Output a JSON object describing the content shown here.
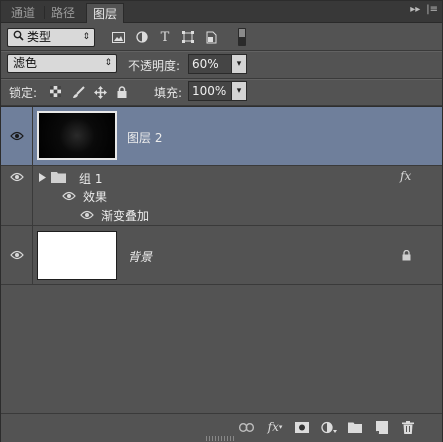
{
  "tabs": [
    {
      "label": "通道"
    },
    {
      "label": "路径"
    },
    {
      "label": "图层"
    }
  ],
  "filter": {
    "kind_label": "类型"
  },
  "blend": {
    "mode": "滤色",
    "opacity_label": "不透明度:",
    "opacity_value": "60%"
  },
  "lock": {
    "label": "锁定:",
    "fill_label": "填充:",
    "fill_value": "100%"
  },
  "layers": {
    "layer2": {
      "name": "图层 2"
    },
    "group1": {
      "name": "组 1",
      "fx": "fx"
    },
    "effects_label": "效果",
    "gradient_overlay": "渐变叠加",
    "background": {
      "name": "背景"
    }
  },
  "colors": {
    "panel_bg": "#535353",
    "selected_row": "#6f7f9b",
    "tabbar_bg": "#383838"
  },
  "bottom": {
    "fx_label": "fx"
  }
}
